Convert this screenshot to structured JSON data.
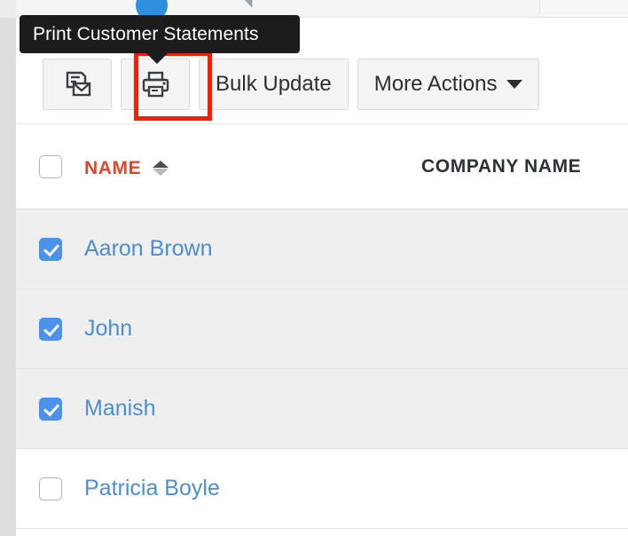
{
  "colors": {
    "tooltip_bg": "#1c1c1c",
    "highlight_ring": "#fb1c05",
    "name_header": "#e0482b",
    "company_header": "#2b3239",
    "link": "#4a8fd4",
    "checkbox_checked": "#4a92ec",
    "selected_row": "#efefef",
    "toolbar_button_bg": "#f4f4f4",
    "gutter": "#dedede"
  },
  "tooltip": {
    "text": "Print Customer Statements",
    "target": "print-statements-button"
  },
  "toolbar": {
    "buttons": [
      {
        "name": "email-statements-button",
        "label": "",
        "icon": "document-envelope-icon",
        "type": "icon"
      },
      {
        "name": "print-statements-button",
        "label": "",
        "icon": "printer-icon",
        "type": "icon",
        "highlighted": true
      },
      {
        "name": "bulk-update-button",
        "label": "Bulk Update",
        "icon": "",
        "type": "text"
      },
      {
        "name": "more-actions-button",
        "label": "More Actions",
        "icon": "chevron-down-icon",
        "type": "dropdown"
      }
    ]
  },
  "table": {
    "columns": [
      {
        "key": "name",
        "label": "NAME",
        "sorted": true,
        "sort_direction": "asc"
      },
      {
        "key": "company",
        "label": "COMPANY NAME",
        "sorted": false
      }
    ],
    "select_all_checked": false,
    "rows": [
      {
        "name": "Aaron Brown",
        "company": "",
        "checked": true
      },
      {
        "name": "John",
        "company": "",
        "checked": true
      },
      {
        "name": "Manish",
        "company": "",
        "checked": true
      },
      {
        "name": "Patricia Boyle",
        "company": "",
        "checked": false
      }
    ]
  }
}
